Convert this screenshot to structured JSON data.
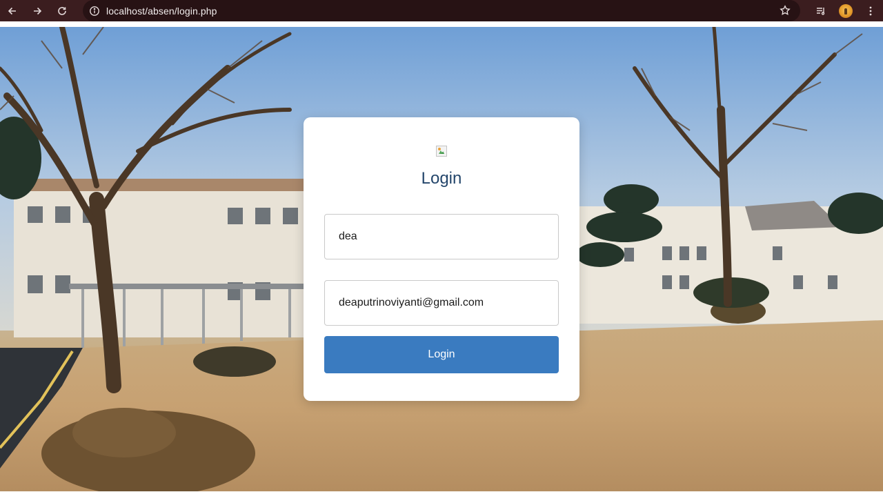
{
  "browser": {
    "url": "localhost/absen/login.php",
    "icons": {
      "back": "arrow-left-icon",
      "forward": "arrow-right-icon",
      "reload": "reload-icon",
      "site_info": "info-icon",
      "bookmark": "star-icon",
      "media": "media-queue-icon",
      "profile": "avatar",
      "menu": "kebab-menu-icon"
    },
    "colors": {
      "frame": "#3b1d1f",
      "address_bar": "#271214"
    }
  },
  "login": {
    "title": "Login",
    "username_value": "dea",
    "email_value": "deaputrinoviyanti@gmail.com",
    "submit_label": "Login",
    "logo_alt": "",
    "colors": {
      "title": "#24466b",
      "button": "#3a7bc0"
    }
  }
}
